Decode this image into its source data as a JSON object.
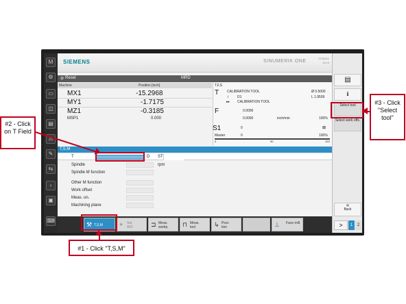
{
  "header": {
    "brand": "SIEMENS",
    "product": "SINUMERIK ONE",
    "clock_line1": "07/26/21",
    "clock_line2": "12:19"
  },
  "status": {
    "reset": "Reset",
    "channel": "MRD"
  },
  "machine": {
    "col_machine": "Machine",
    "col_position": "Position [inch]",
    "axes": [
      {
        "name": "MX1",
        "value": "-15.2968"
      },
      {
        "name": "MY1",
        "value": "-1.7175"
      },
      {
        "name": "MZ1",
        "value": "-0.3185"
      },
      {
        "name": "MSP1",
        "value": "0.000"
      }
    ]
  },
  "tfs": {
    "title": "T,F,S",
    "t_letter": "T",
    "tool": "CALIBRATION TOOL",
    "diameter": "Ø 0.5000",
    "d_prefix": "i",
    "d_value": "D1",
    "length": "L 1.9509",
    "next_prefix": "▸▸",
    "next_tool": "CALIBRATION TOOL",
    "f_letter": "F",
    "f_value": "0.0000",
    "f_value2": "0.0000",
    "f_unit": "inch/min",
    "f_pct": "100%",
    "s_letter": "S1",
    "s_value": "0",
    "master": "Master",
    "master_value": "0",
    "s_pct": "100%",
    "scale_0": "0",
    "scale_50": "50",
    "scale_100": "100"
  },
  "tsm": {
    "title": "T,S,M",
    "t_label": "T",
    "d_label": "D",
    "st_label": "ST",
    "rows": [
      "Spindle",
      "Spindle M function",
      "Other M function",
      "Work offset",
      "Meas. un.",
      "Machining plane"
    ],
    "rpm": "rpm"
  },
  "softkeys": {
    "tsm": "T,S,M",
    "set_wo": "Set WO",
    "meas_workp": "Meas. workp.",
    "meas_tool": "Meas. tool",
    "position": "Posi- tion",
    "face_mill": "Face mill."
  },
  "right_softkeys": {
    "select_tool": "Select tool",
    "select_work_offs": "Select work offs.",
    "back": "Back",
    "more": ">",
    "page1": "1",
    "page2": "2",
    "back_arrows": "«"
  },
  "annotations": {
    "step1": "#1 - Click \"T,S,M\"",
    "step2": "#2 - Click on T Field",
    "step3": "#3 - Click \"Select tool\""
  },
  "colors": {
    "accent": "#2e8fc6",
    "annotation": "#c0001f",
    "brand": "#00828c"
  }
}
